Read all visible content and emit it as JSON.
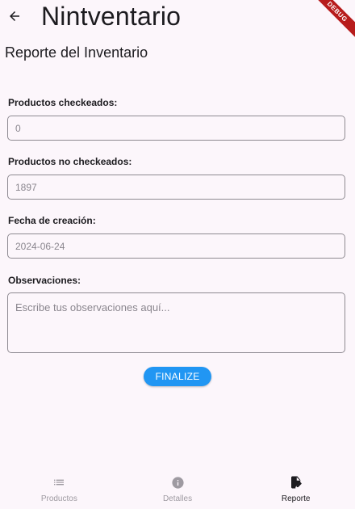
{
  "appbar": {
    "title": "Nintventario",
    "debug_banner": "DEBUG"
  },
  "page": {
    "section_title": "Reporte del Inventario"
  },
  "form": {
    "checked_label": "Productos checkeados:",
    "checked_value": "0",
    "unchecked_label": "Productos no checkeados:",
    "unchecked_value": "1897",
    "created_label": "Fecha de creación:",
    "created_value": "2024-06-24",
    "notes_label": "Observaciones:",
    "notes_placeholder": "Escribe tus observaciones aquí...",
    "finalize_label": "FINALIZE"
  },
  "nav": {
    "items": [
      {
        "label": "Productos",
        "icon": "list-icon",
        "active": false
      },
      {
        "label": "Detalles",
        "icon": "info-icon",
        "active": false
      },
      {
        "label": "Reporte",
        "icon": "report-edit-icon",
        "active": true
      }
    ]
  },
  "colors": {
    "accent": "#2196f3",
    "background": "#fcf6fb",
    "debug": "#b71c1c"
  }
}
